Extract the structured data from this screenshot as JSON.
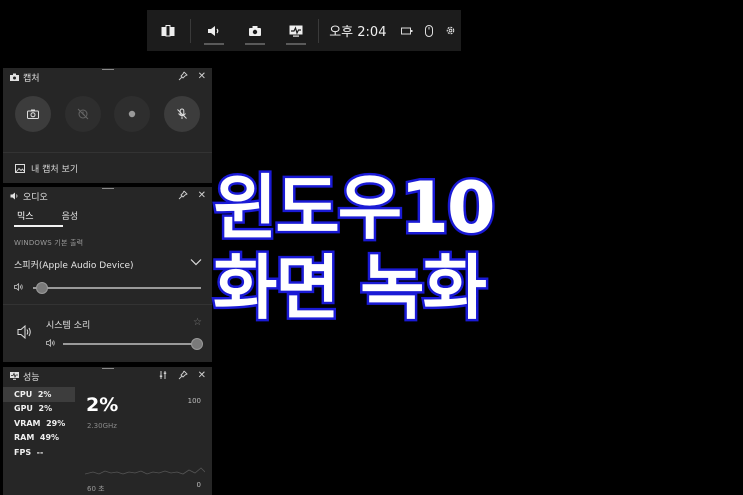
{
  "topbar": {
    "time": "오후 2:04",
    "buttons": [
      "widget-menu",
      "audio",
      "capture",
      "performance"
    ]
  },
  "capture": {
    "title": "캡처",
    "gallery_link": "내 캡처 보기"
  },
  "audio": {
    "title": "오디오",
    "tabs": [
      "믹스",
      "음성"
    ],
    "section_label": "WINDOWS 기본 출력",
    "device": "스피커(Apple Audio Device)",
    "device_volume": 0.05,
    "app_label": "시스템 소리",
    "app_volume": 1.0
  },
  "performance": {
    "title": "성능",
    "metrics": [
      {
        "name": "CPU",
        "value": "2%"
      },
      {
        "name": "GPU",
        "value": "2%"
      },
      {
        "name": "VRAM",
        "value": "29%"
      },
      {
        "name": "RAM",
        "value": "49%"
      },
      {
        "name": "FPS",
        "value": "--"
      }
    ],
    "current": "2%",
    "frequency": "2.30GHz",
    "max_label": "100",
    "min_label": "0",
    "time_label": "60 초"
  },
  "overlay": {
    "line1": "윈도우10",
    "line2": "화면 녹화"
  },
  "colors": {
    "overlay_stroke": "#1b1bd6",
    "panel_bg": "#262626",
    "topbar_bg": "#1c1c1c"
  }
}
